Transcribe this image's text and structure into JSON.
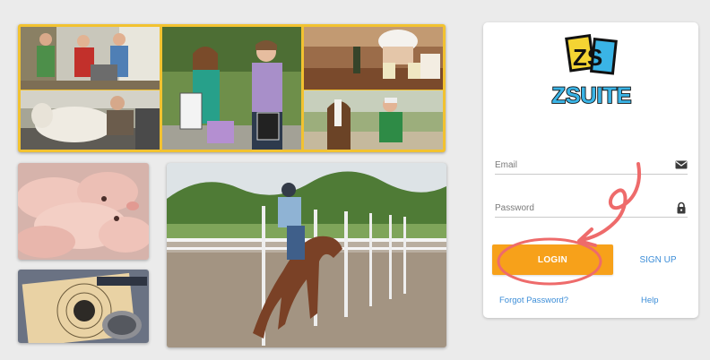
{
  "brand": {
    "logo_monogram": "ZS",
    "logo_wordmark": "ZSUITE",
    "colors": {
      "primary_button": "#f7a11a",
      "link": "#3d8ed8",
      "logo_blue": "#3ab4e6",
      "logo_yellow": "#f4d433",
      "annotation": "#ee6b6b"
    }
  },
  "login_form": {
    "email_label": "Email",
    "email_icon": "envelope-icon",
    "password_label": "Password",
    "password_icon": "lock-icon",
    "login_label": "LOGIN",
    "signup_label": "SIGN UP",
    "forgot_label": "Forgot Password?",
    "help_label": "Help"
  },
  "photos": [
    "kids-with-robot",
    "students-with-awards",
    "baking-contest",
    "sheep-grooming",
    "horse-and-boy",
    "piglets",
    "target-shooting",
    "barrel-racing"
  ]
}
